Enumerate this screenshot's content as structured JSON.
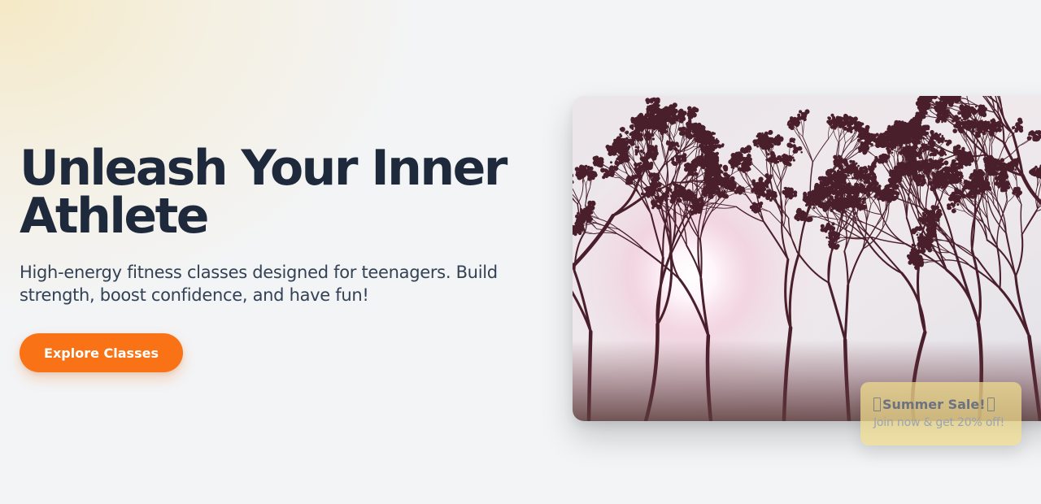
{
  "hero": {
    "headline": "Unleash Your Inner Athlete",
    "subtitle": "High-energy fitness classes designed for teenagers. Build strength, boost confidence, and have fun!",
    "cta_label": "Explore Classes"
  },
  "image": {
    "alt": "Sunlight through blossoming tree branches"
  },
  "promo": {
    "title": "Summer Sale!",
    "subtitle": "Join now & get 20% off!"
  },
  "colors": {
    "accent": "#f97316",
    "headline": "#1e293b",
    "promo_bg": "#f0dc8c"
  }
}
